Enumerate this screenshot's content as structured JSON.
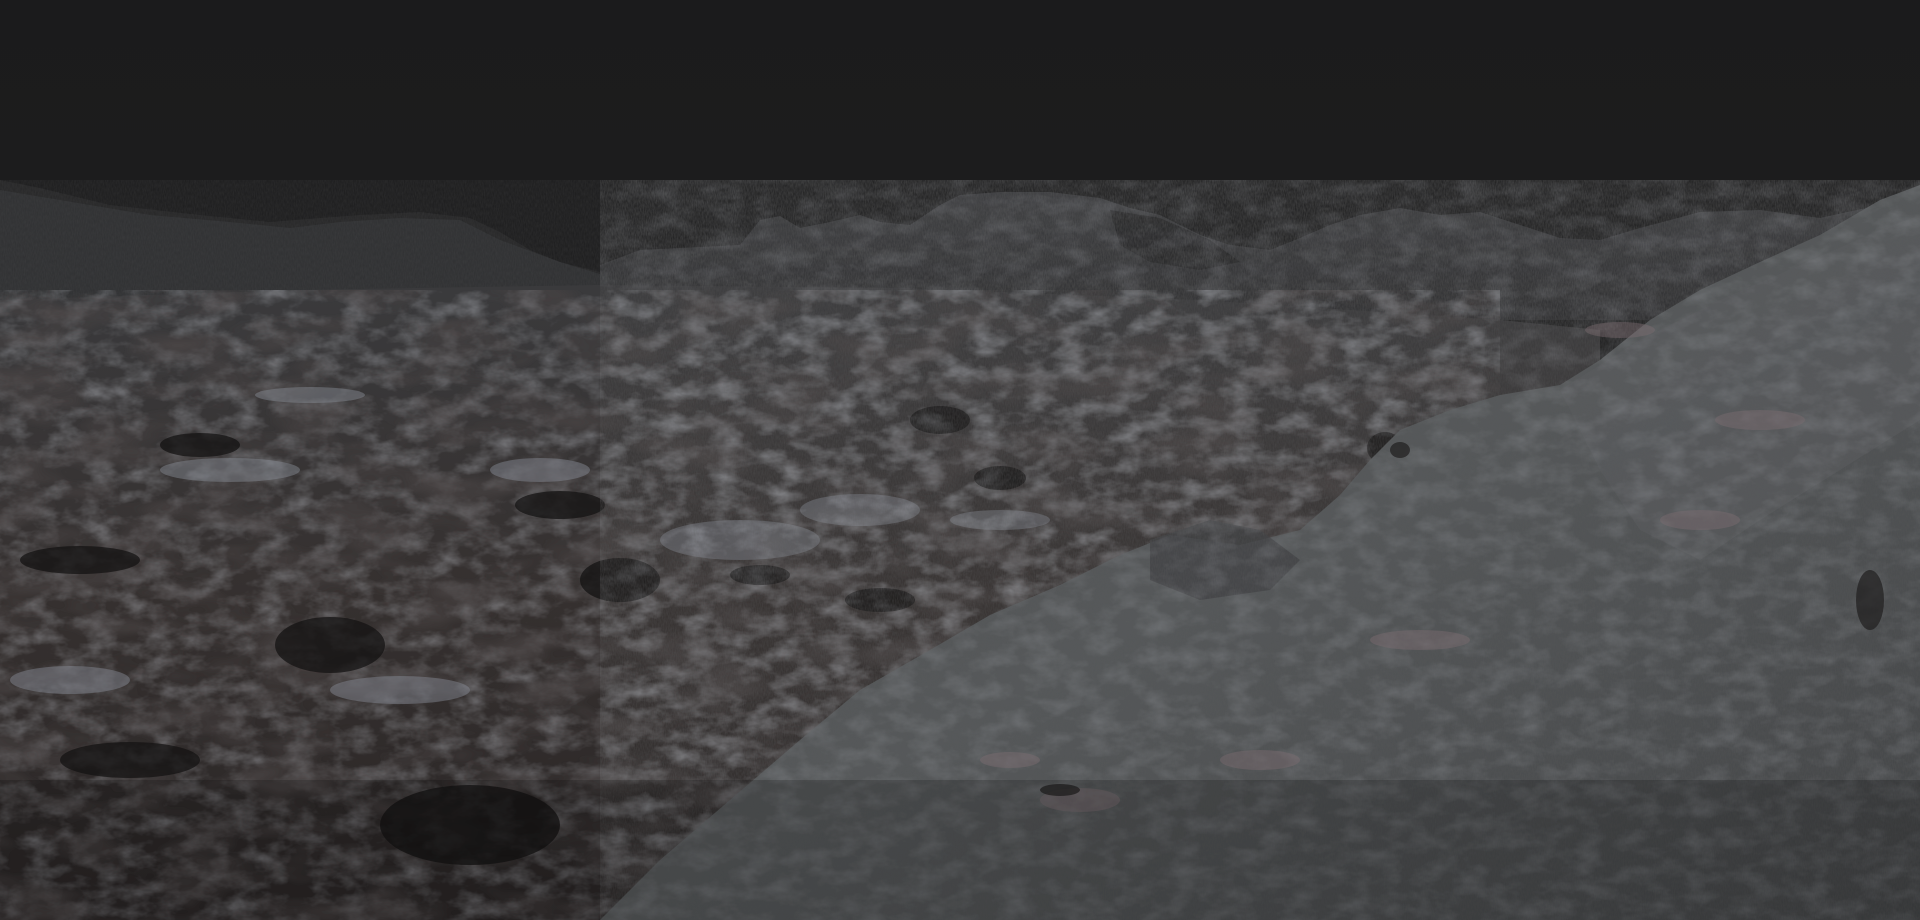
{
  "scene": {
    "subject": "rendered-rocky-terrain",
    "colors": {
      "sky": "#1c1c1d",
      "far_ridge": "#2e2f31",
      "mid_ridge": "#3a3b3e",
      "plain_dark": "#2a2828",
      "plain_mid": "#3f3d3d",
      "plain_light": "#6b6e74",
      "highlight": "#8c9099",
      "slope_base": "#45484a",
      "slope_light": "#5e6062",
      "rust": "#4a3a35",
      "pink_tint": "#7d6d72",
      "shadow": "#141313"
    }
  }
}
